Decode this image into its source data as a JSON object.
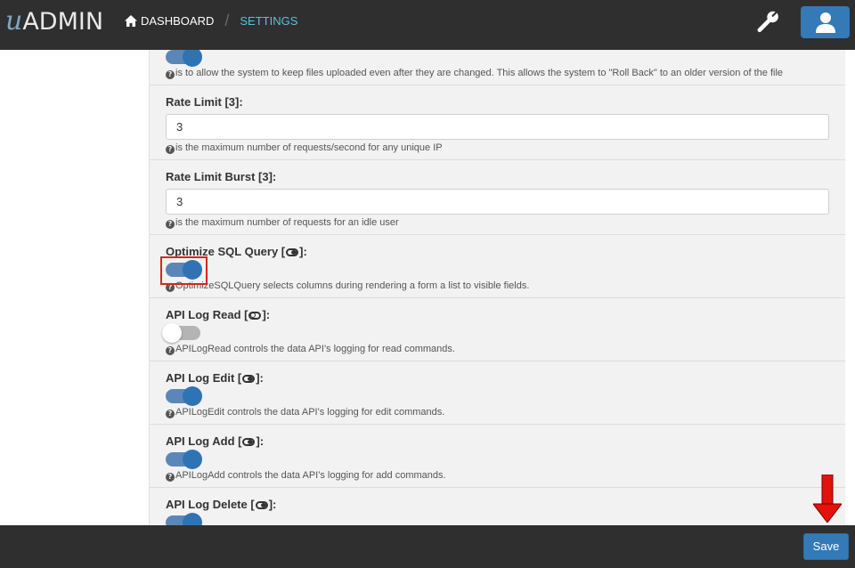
{
  "header": {
    "logo_u": "u",
    "logo_admin": "ADMIN",
    "breadcrumb_home": "DASHBOARD",
    "breadcrumb_separator": "/",
    "breadcrumb_current": "SETTINGS",
    "accent_color": "#5bc0de",
    "icons": {
      "home": "home-icon",
      "settings": "wrench-icon",
      "user": "user-icon"
    }
  },
  "settings": [
    {
      "label": "",
      "type": "toggle",
      "value": "on",
      "help": "is to allow the system to keep files uploaded even after they are changed. This allows the system to \"Roll Back\" to an older version of the file"
    },
    {
      "label": "Rate Limit [3]:",
      "type": "text",
      "value": "3",
      "help": "is the maximum number of requests/second for any unique IP"
    },
    {
      "label": "Rate Limit Burst [3]:",
      "type": "text",
      "value": "3",
      "help": "is the maximum number of requests for an idle user"
    },
    {
      "label_prefix": "Optimize SQL Query [",
      "label_suffix": "]:",
      "type": "toggle",
      "value": "on",
      "help": "OptimizeSQLQuery selects columns during rendering a form a list to visible fields."
    },
    {
      "label_prefix": "API Log Read [",
      "label_suffix": "]:",
      "type": "toggle",
      "value": "off",
      "help": "APILogRead controls the data API's logging for read commands."
    },
    {
      "label_prefix": "API Log Edit [",
      "label_suffix": "]:",
      "type": "toggle",
      "value": "on",
      "help": "APILogEdit controls the data API's logging for edit commands."
    },
    {
      "label_prefix": "API Log Add [",
      "label_suffix": "]:",
      "type": "toggle",
      "value": "on",
      "help": "APILogAdd controls the data API's logging for add commands."
    },
    {
      "label_prefix": "API Log Delete [",
      "label_suffix": "]:",
      "type": "toggle",
      "value": "on",
      "help": ""
    }
  ],
  "footer": {
    "save_label": "Save"
  },
  "annotations": {
    "highlight_color": "#d9251c",
    "arrow_color": "#e3120b"
  }
}
